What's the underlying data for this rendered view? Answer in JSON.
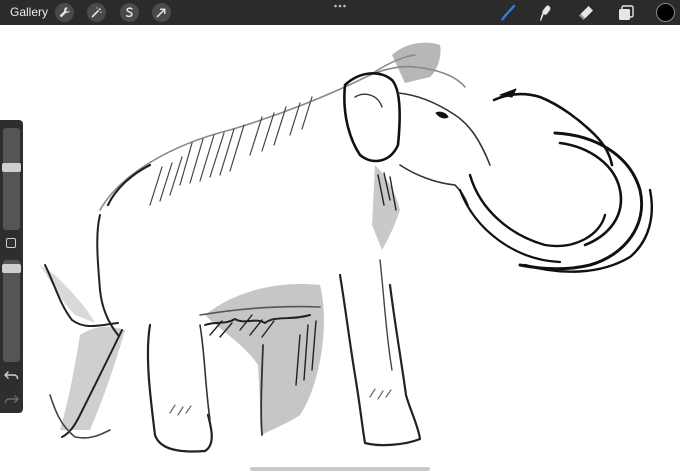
{
  "topbar": {
    "gallery_label": "Gallery",
    "left_tools": [
      {
        "icon": "wrench-icon"
      },
      {
        "icon": "magic-wand-icon"
      },
      {
        "icon": "selection-icon"
      },
      {
        "icon": "transform-arrow-icon"
      }
    ],
    "right_tools": [
      {
        "icon": "brush-icon",
        "active": true
      },
      {
        "icon": "smudge-icon"
      },
      {
        "icon": "eraser-icon"
      },
      {
        "icon": "layers-icon"
      }
    ],
    "current_color": "#000000",
    "accent_color": "#2f7fe5"
  },
  "sidebar": {
    "brush_size_level": 0.62,
    "opacity_level": 0.96,
    "modify_icon": "square-icon",
    "undo_icon": "undo-icon",
    "redo_icon": "redo-icon"
  },
  "canvas": {
    "subject": "woolly-mammoth-sketch"
  }
}
